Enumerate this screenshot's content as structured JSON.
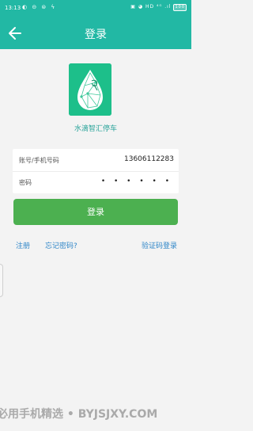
{
  "status_bar": {
    "time": "13:13",
    "left_icons": "◐ ⊝ ⊜ ϟ",
    "right_icons": "▣ ◕ HD ⁴ᴳ .ıl",
    "battery": "100"
  },
  "header": {
    "title": "登录"
  },
  "app": {
    "name": "水滴智汇停车"
  },
  "form": {
    "account_label": "账号/手机号码",
    "account_value": "13606112283",
    "password_label": "密码",
    "password_value": "• • • • • •"
  },
  "actions": {
    "login_label": "登录",
    "register_label": "注册",
    "forgot_label": "忘记密码?",
    "sms_login_label": "验证码登录"
  },
  "watermark": {
    "text": "必用手机精选 • BYJSJXY.COM"
  },
  "colors": {
    "brand": "#22b8a4",
    "button": "#4cb050",
    "link": "#2f86c8"
  }
}
